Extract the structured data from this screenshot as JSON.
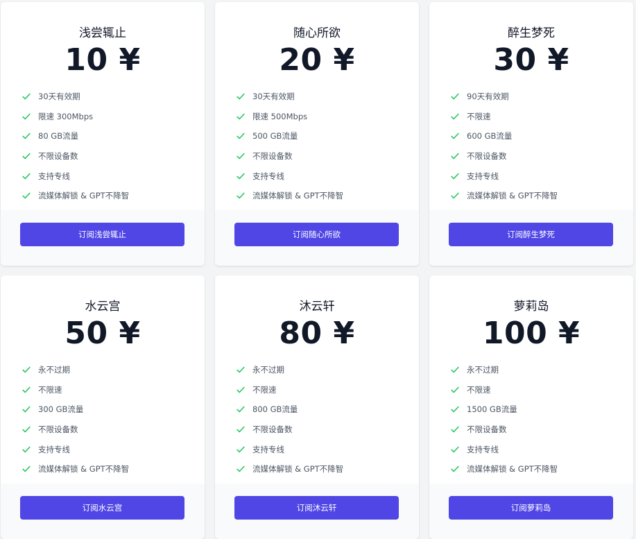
{
  "theme": {
    "accent": "#4f46e5",
    "check": "#22c55e"
  },
  "plans": [
    {
      "name": "浅尝辄止",
      "price": "10 ¥",
      "button": "订阅浅尝辄止",
      "features": [
        "30天有效期",
        "限速 300Mbps",
        "80 GB流量",
        "不限设备数",
        "支持专线",
        "流媒体解锁 & GPT不降智"
      ]
    },
    {
      "name": "随心所欲",
      "price": "20 ¥",
      "button": "订阅随心所欲",
      "features": [
        "30天有效期",
        "限速 500Mbps",
        "500 GB流量",
        "不限设备数",
        "支持专线",
        "流媒体解锁 & GPT不降智"
      ]
    },
    {
      "name": "醉生梦死",
      "price": "30 ¥",
      "button": "订阅醉生梦死",
      "features": [
        "90天有效期",
        "不限速",
        "600 GB流量",
        "不限设备数",
        "支持专线",
        "流媒体解锁 & GPT不降智"
      ]
    },
    {
      "name": "水云宫",
      "price": "50 ¥",
      "button": "订阅水云宫",
      "features": [
        "永不过期",
        "不限速",
        "300 GB流量",
        "不限设备数",
        "支持专线",
        "流媒体解锁 & GPT不降智"
      ]
    },
    {
      "name": "沐云轩",
      "price": "80 ¥",
      "button": "订阅沐云轩",
      "features": [
        "永不过期",
        "不限速",
        "800 GB流量",
        "不限设备数",
        "支持专线",
        "流媒体解锁 & GPT不降智"
      ]
    },
    {
      "name": "萝莉岛",
      "price": "100 ¥",
      "button": "订阅萝莉岛",
      "features": [
        "永不过期",
        "不限速",
        "1500 GB流量",
        "不限设备数",
        "支持专线",
        "流媒体解锁 & GPT不降智"
      ]
    }
  ]
}
